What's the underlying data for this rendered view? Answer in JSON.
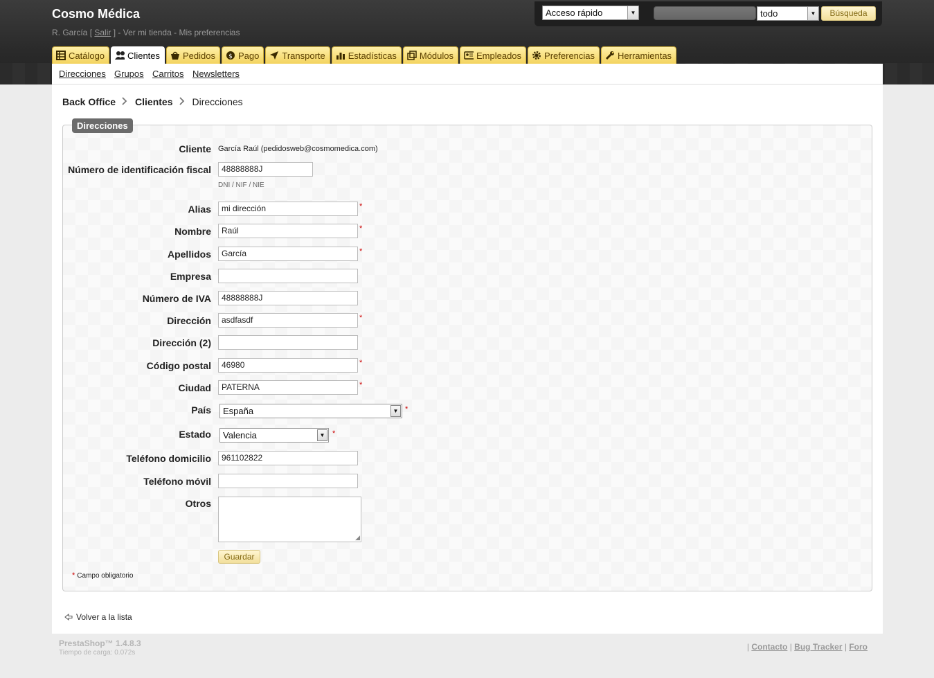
{
  "header": {
    "shop_name": "Cosmo Médica",
    "user_name": "R. García",
    "logout": "Salir",
    "view_shop": "Ver mi tienda",
    "preferences": "Mis preferencias",
    "quick_access": "Acceso rápido",
    "search_type": "todo",
    "search_button": "Búsqueda"
  },
  "tabs": [
    {
      "label": "Catálogo",
      "icon": "catalog-icon"
    },
    {
      "label": "Clientes",
      "icon": "customers-icon",
      "active": true
    },
    {
      "label": "Pedidos",
      "icon": "orders-icon"
    },
    {
      "label": "Pago",
      "icon": "payment-icon"
    },
    {
      "label": "Transporte",
      "icon": "shipping-icon"
    },
    {
      "label": "Estadísticas",
      "icon": "stats-icon"
    },
    {
      "label": "Módulos",
      "icon": "modules-icon"
    },
    {
      "label": "Empleados",
      "icon": "employees-icon"
    },
    {
      "label": "Preferencias",
      "icon": "gear-icon"
    },
    {
      "label": "Herramientas",
      "icon": "wrench-icon"
    }
  ],
  "subtabs": [
    "Direcciones",
    "Grupos",
    "Carritos",
    "Newsletters"
  ],
  "breadcrumb": [
    "Back Office",
    "Clientes",
    "Direcciones"
  ],
  "form": {
    "legend": "Direcciones",
    "customer_label": "Cliente",
    "customer_value": "García Raúl (pedidosweb@cosmomedica.com)",
    "dni_label": "Número de identificación fiscal",
    "dni_value": "48888888J",
    "dni_hint": "DNI / NIF / NIE",
    "alias_label": "Alias",
    "alias_value": "mi dirección",
    "firstname_label": "Nombre",
    "firstname_value": "Raúl",
    "lastname_label": "Apellidos",
    "lastname_value": "García",
    "company_label": "Empresa",
    "company_value": "",
    "vat_label": "Número de IVA",
    "vat_value": "48888888J",
    "address1_label": "Dirección",
    "address1_value": "asdfasdf",
    "address2_label": "Dirección (2)",
    "address2_value": "",
    "postcode_label": "Código postal",
    "postcode_value": "46980",
    "city_label": "Ciudad",
    "city_value": "PATERNA",
    "country_label": "País",
    "country_value": "España",
    "state_label": "Estado",
    "state_value": "Valencia",
    "phone_label": "Teléfono domicilio",
    "phone_value": "961102822",
    "mobile_label": "Teléfono móvil",
    "mobile_value": "",
    "other_label": "Otros",
    "other_value": "",
    "save_button": "Guardar",
    "required_mark": "*",
    "required_note": "Campo obligatorio"
  },
  "back_link": "Volver a la lista",
  "footer": {
    "version": "PrestaShop™ 1.4.8.3",
    "load_time": "Tiempo de carga: 0.072s",
    "links": [
      "Contacto",
      "Bug Tracker",
      "Foro"
    ]
  },
  "colors": {
    "tab_gradient_top": "#fff0a8",
    "tab_gradient_bottom": "#f3d35e",
    "legend_bg": "#6b6b6b",
    "required": "#cc0000",
    "header_bg": "#333333"
  }
}
